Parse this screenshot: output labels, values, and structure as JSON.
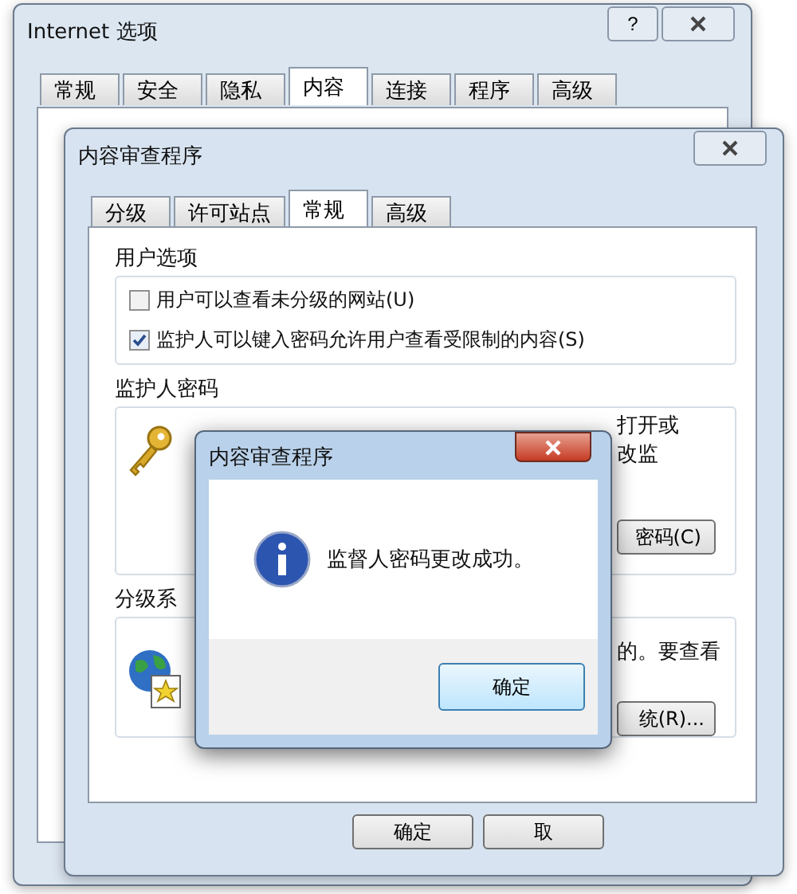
{
  "outer_window": {
    "title": "Internet 选项",
    "help": "?",
    "tabs": [
      {
        "label": "常规",
        "selected": false
      },
      {
        "label": "安全",
        "selected": false
      },
      {
        "label": "隐私",
        "selected": false
      },
      {
        "label": "内容",
        "selected": true
      },
      {
        "label": "连接",
        "selected": false
      },
      {
        "label": "程序",
        "selected": false
      },
      {
        "label": "高级",
        "selected": false
      }
    ]
  },
  "content_advisor": {
    "title": "内容审查程序",
    "tabs": [
      {
        "label": "分级",
        "selected": false
      },
      {
        "label": "许可站点",
        "selected": false
      },
      {
        "label": "常规",
        "selected": true
      },
      {
        "label": "高级",
        "selected": false
      }
    ],
    "user_options": {
      "label": "用户选项",
      "options": [
        {
          "label": "用户可以查看未分级的网站(U)",
          "checked": false
        },
        {
          "label": "监护人可以键入密码允许用户查看受限制的内容(S)",
          "checked": true
        }
      ]
    },
    "supervisor_password": {
      "label": "监护人密码",
      "description_lines": [
        "打开或",
        "改监"
      ],
      "button": "密码(C)"
    },
    "rating_systems": {
      "label": "分级系",
      "description": "的。要查看",
      "button": "统(R)..."
    },
    "buttons": [
      "确定",
      "取"
    ]
  },
  "message_box": {
    "title": "内容审查程序",
    "message": "监督人密码更改成功。",
    "button": "确定"
  }
}
